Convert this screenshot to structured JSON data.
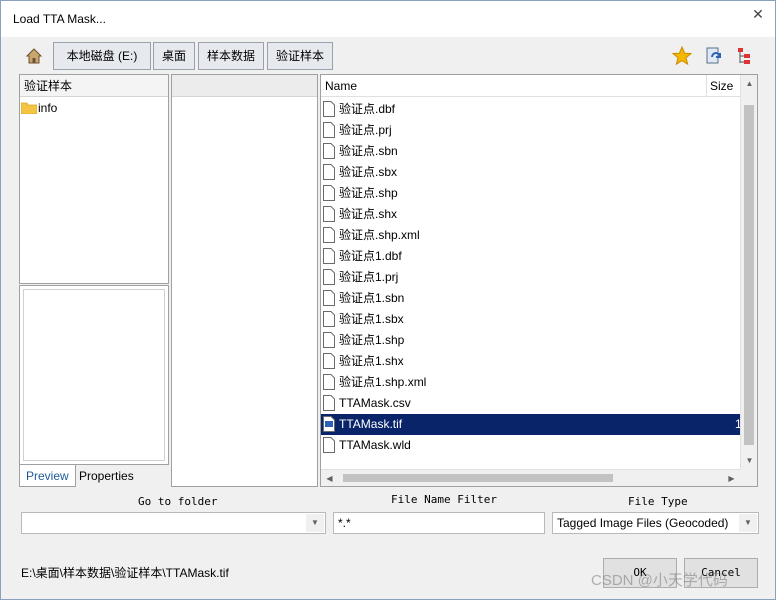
{
  "window": {
    "title": "Load TTA Mask..."
  },
  "toolbar": {
    "breadcrumb": [
      "本地磁盘 (E:)",
      "桌面",
      "样本数据",
      "验证样本"
    ],
    "icons": [
      "home-icon",
      "favorites-star-icon",
      "refresh-icon",
      "tree-view-icon"
    ]
  },
  "folder_pane": {
    "header": "验证样本",
    "items": [
      {
        "label": "info"
      }
    ]
  },
  "info_tabs": {
    "preview": "Preview",
    "properties": "Properties"
  },
  "file_list": {
    "columns": {
      "name": "Name",
      "size": "Size"
    },
    "files": [
      {
        "name": "验证点.dbf",
        "size": ""
      },
      {
        "name": "验证点.prj",
        "size": ""
      },
      {
        "name": "验证点.sbn",
        "size": ""
      },
      {
        "name": "验证点.sbx",
        "size": ""
      },
      {
        "name": "验证点.shp",
        "size": ""
      },
      {
        "name": "验证点.shx",
        "size": ""
      },
      {
        "name": "验证点.shp.xml",
        "size": ""
      },
      {
        "name": "验证点1.dbf",
        "size": ""
      },
      {
        "name": "验证点1.prj",
        "size": ""
      },
      {
        "name": "验证点1.sbn",
        "size": ""
      },
      {
        "name": "验证点1.sbx",
        "size": ""
      },
      {
        "name": "验证点1.shp",
        "size": ""
      },
      {
        "name": "验证点1.shx",
        "size": ""
      },
      {
        "name": "验证点1.shp.xml",
        "size": ""
      },
      {
        "name": "TTAMask.csv",
        "size": ""
      },
      {
        "name": "TTAMask.tif",
        "size": "1",
        "selected": true
      },
      {
        "name": "TTAMask.wld",
        "size": ""
      }
    ]
  },
  "go_to_folder": {
    "label": "Go to folder",
    "value": ""
  },
  "file_name_filter": {
    "label": "File Name Filter",
    "value": "*.*"
  },
  "file_type": {
    "label": "File Type",
    "value": "Tagged Image Files (Geocoded)"
  },
  "selected_path": "E:\\桌面\\样本数据\\验证样本\\TTAMask.tif",
  "buttons": {
    "ok": "OK",
    "cancel": "Cancel"
  },
  "watermark": "CSDN @小天学代码",
  "colors": {
    "selection": "#0a246a",
    "star": "#f5b800"
  }
}
